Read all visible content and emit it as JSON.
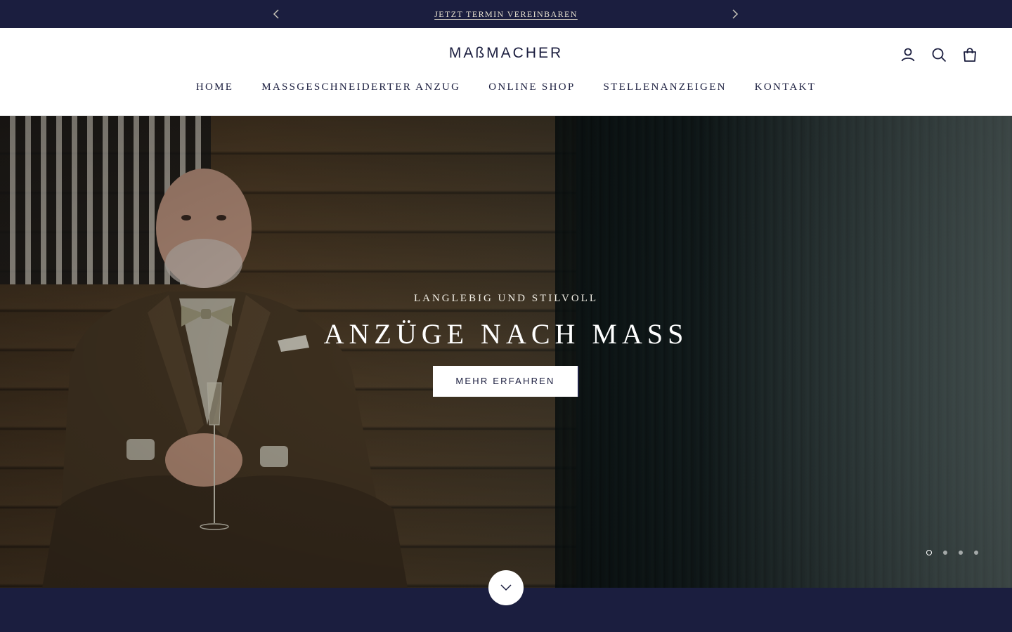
{
  "announcement": {
    "text": "JETZT TERMIN VEREINBAREN",
    "prev_icon": "chevron-left-icon",
    "next_icon": "chevron-right-icon"
  },
  "header": {
    "logo": "MAßMACHER",
    "icons": [
      "account-icon",
      "search-icon",
      "cart-icon"
    ],
    "nav": [
      {
        "label": "HOME"
      },
      {
        "label": "MASSGESCHNEIDERTER ANZUG"
      },
      {
        "label": "ONLINE SHOP"
      },
      {
        "label": "STELLENANZEIGEN"
      },
      {
        "label": "KONTAKT"
      }
    ]
  },
  "hero": {
    "kicker": "LANGLEBIG UND STILVOLL",
    "title": "ANZÜGE NACH MASS",
    "button": "MEHR ERFAHREN",
    "slides_total": 4,
    "active_slide": 1
  },
  "scroll_icon": "chevron-down-icon",
  "colors": {
    "navy": "#1b1e3f",
    "white": "#ffffff"
  }
}
